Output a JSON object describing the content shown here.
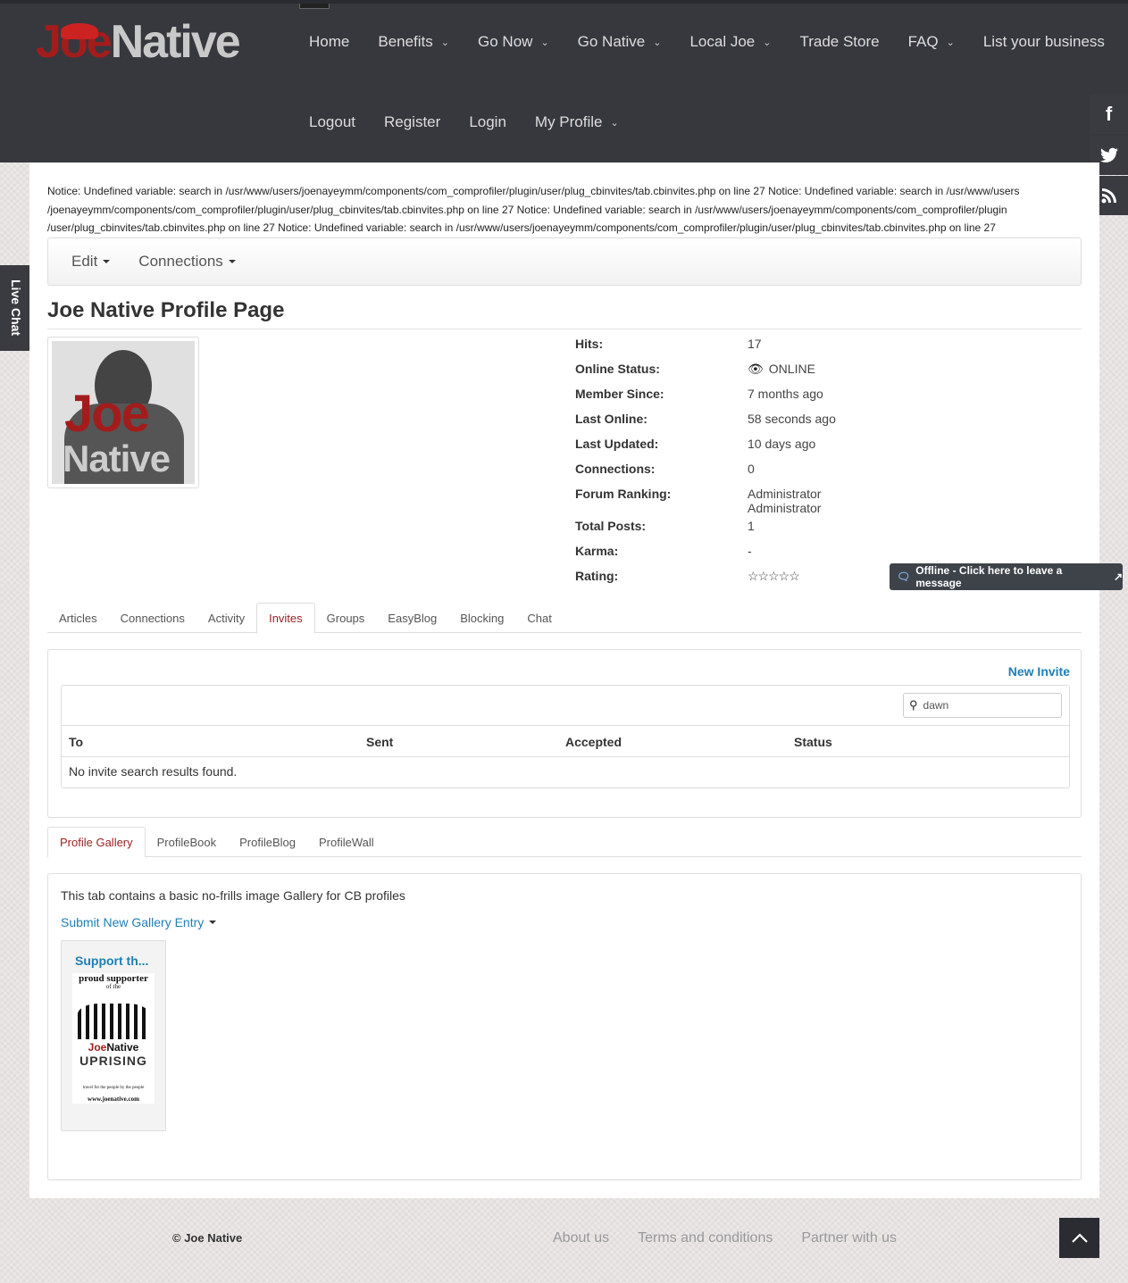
{
  "header": {
    "logo_joe": "Joe",
    "logo_native": "Native",
    "nav_row1": [
      {
        "label": "Home",
        "dropdown": false
      },
      {
        "label": "Benefits",
        "dropdown": true
      },
      {
        "label": "Go Now",
        "dropdown": true
      },
      {
        "label": "Go Native",
        "dropdown": true
      },
      {
        "label": "Local Joe",
        "dropdown": true
      },
      {
        "label": "Trade Store",
        "dropdown": false
      },
      {
        "label": "FAQ",
        "dropdown": true
      },
      {
        "label": "List your business",
        "dropdown": false
      }
    ],
    "nav_row2": [
      {
        "label": "Logout",
        "dropdown": false
      },
      {
        "label": "Register",
        "dropdown": false
      },
      {
        "label": "Login",
        "dropdown": false
      },
      {
        "label": "My Profile",
        "dropdown": true
      }
    ]
  },
  "social": {
    "facebook": "f",
    "twitter": "twitter-icon",
    "rss": "rss-icon"
  },
  "livechat": {
    "label": "Live Chat"
  },
  "notice": "Notice: Undefined variable: search in /usr/www/users/joenayeymm/components/com_comprofiler/plugin/user/plug_cbinvites/tab.cbinvites.php on line 27 Notice: Undefined variable: search in /usr/www/users /joenayeymm/components/com_comprofiler/plugin/user/plug_cbinvites/tab.cbinvites.php on line 27 Notice: Undefined variable: search in /usr/www/users/joenayeymm/components/com_comprofiler/plugin /user/plug_cbinvites/tab.cbinvites.php on line 27 Notice: Undefined variable: search in /usr/www/users/joenayeymm/components/com_comprofiler/plugin/user/plug_cbinvites/tab.cbinvites.php on line 27",
  "menubar": {
    "edit": "Edit",
    "connections": "Connections"
  },
  "profile": {
    "title": "Joe Native Profile Page",
    "avatar_joe": "Joe",
    "avatar_native": "Native",
    "stats": [
      {
        "key": "Hits:",
        "value": "17"
      },
      {
        "key": "Online Status:",
        "value": "ONLINE"
      },
      {
        "key": "Member Since:",
        "value": "7 months ago"
      },
      {
        "key": "Last Online:",
        "value": "58 seconds ago"
      },
      {
        "key": "Last Updated:",
        "value": "10 days ago"
      },
      {
        "key": "Connections:",
        "value": "0"
      },
      {
        "key": "Forum Ranking:",
        "value": "Administrator",
        "value2": "Administrator"
      },
      {
        "key": "Total Posts:",
        "value": "1"
      },
      {
        "key": "Karma:",
        "value": "-"
      },
      {
        "key": "Rating:",
        "value": "☆☆☆☆☆"
      }
    ],
    "online_color": "#6a9b34"
  },
  "chat_offline": {
    "label": "Offline - Click here to leave a message"
  },
  "tabs1": {
    "items": [
      "Articles",
      "Connections",
      "Activity",
      "Invites",
      "Groups",
      "EasyBlog",
      "Blocking",
      "Chat"
    ],
    "active": "Invites"
  },
  "invites": {
    "new_invite": "New Invite",
    "search_value": "dawn",
    "columns": [
      "To",
      "Sent",
      "Accepted",
      "Status"
    ],
    "empty_message": "No invite search results found."
  },
  "tabs2": {
    "items": [
      "Profile Gallery",
      "ProfileBook",
      "ProfileBlog",
      "ProfileWall"
    ],
    "active": "Profile Gallery"
  },
  "gallery": {
    "description": "This tab contains a basic no-frills image Gallery for CB profiles",
    "submit": "Submit New Gallery Entry",
    "item_title": "Support th...",
    "poster": {
      "line1": "proud supporter",
      "line2": "of the",
      "brand_joe": "Joe",
      "brand_native": "Native",
      "uprising": "UPRISING",
      "tagline": "travel for the people by the people",
      "url": "www.joenative.com"
    }
  },
  "footer": {
    "copyright": "© Joe Native",
    "links": [
      "About us",
      "Terms and conditions",
      "Partner with us"
    ]
  },
  "colors": {
    "accent": "#1e80b3",
    "brand_red": "#a31c1c",
    "header_bg": "#37383e"
  }
}
